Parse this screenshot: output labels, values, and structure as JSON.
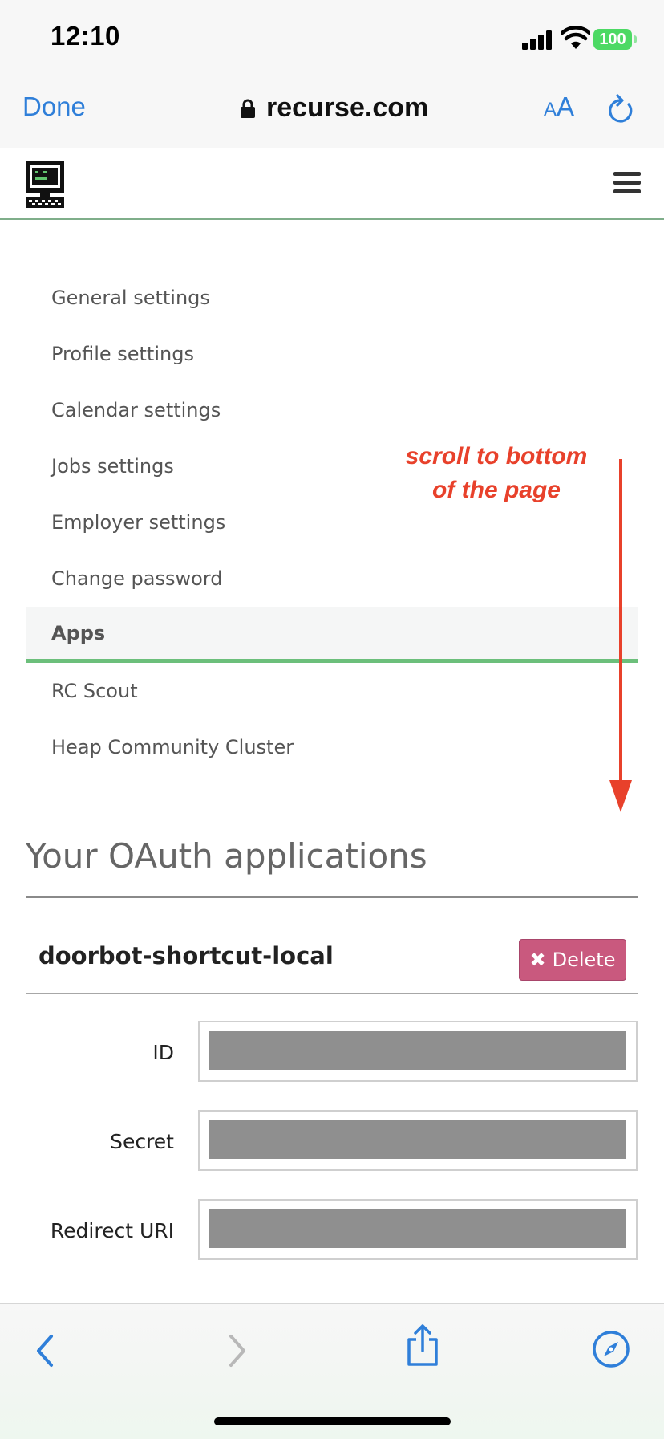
{
  "status_bar": {
    "time": "12:10",
    "battery": "100"
  },
  "browser": {
    "done_label": "Done",
    "url": "recurse.com",
    "text_size_small": "A",
    "text_size_big": "A"
  },
  "settings_menu": {
    "items": [
      {
        "label": "General settings",
        "active": false
      },
      {
        "label": "Profile settings",
        "active": false
      },
      {
        "label": "Calendar settings",
        "active": false
      },
      {
        "label": "Jobs settings",
        "active": false
      },
      {
        "label": "Employer settings",
        "active": false
      },
      {
        "label": "Change password",
        "active": false
      },
      {
        "label": "Apps",
        "active": true
      },
      {
        "label": "RC Scout",
        "active": false
      },
      {
        "label": "Heap Community Cluster",
        "active": false
      }
    ]
  },
  "annotation": {
    "line1": "scroll to bottom",
    "line2": "of the page",
    "color": "#e8412b"
  },
  "oauth": {
    "title": "Your OAuth applications",
    "app": {
      "name": "doorbot-shortcut-local",
      "delete_icon": "✖",
      "delete_label": "Delete",
      "fields": [
        {
          "label": "ID"
        },
        {
          "label": "Secret"
        },
        {
          "label": "Redirect URI"
        }
      ]
    }
  },
  "colors": {
    "accent_blue": "#2f7fd9",
    "active_green": "#6cbf7b",
    "delete_pink": "#c9597e",
    "battery_green": "#4cd964"
  }
}
